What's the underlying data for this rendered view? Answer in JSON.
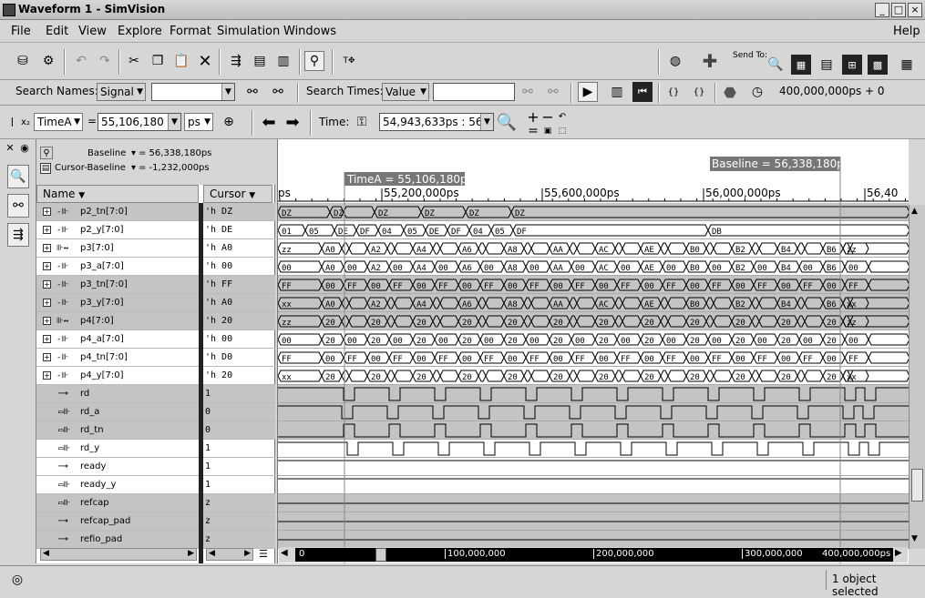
{
  "window": {
    "title": "Waveform 1 - SimVision"
  },
  "menu": [
    {
      "label": "File",
      "name": "menu-file"
    },
    {
      "label": "Edit",
      "name": "menu-edit"
    },
    {
      "label": "View",
      "name": "menu-view"
    },
    {
      "label": "Explore",
      "name": "menu-explore"
    },
    {
      "label": "Format",
      "name": "menu-format"
    },
    {
      "label": "Simulation",
      "name": "menu-simulation"
    },
    {
      "label": "Windows",
      "name": "menu-windows"
    }
  ],
  "menu_help": "Help",
  "toolbar1": {
    "send_to_label": "Send To:"
  },
  "toolbar2": {
    "search_names_label": "Search Names:",
    "search_names_type": "Signal",
    "search_names_value": "",
    "search_times_label": "Search Times:",
    "search_times_type": "Value",
    "search_times_value": "",
    "sim_time": "400,000,000ps + 0"
  },
  "toolbar3": {
    "cursor_name": "TimeA",
    "cursor_value": "55,106,180",
    "cursor_units": "ps",
    "time_label": "Time:",
    "time_range": "54,943,633ps : 56,"
  },
  "namepane": {
    "baseline_label": "Baseline",
    "baseline_value": "= 56,338,180ps",
    "cursor_baseline_label": "Cursor-Baseline",
    "cursor_baseline_value": "= -1,232,000ps",
    "col_name": "Name",
    "col_cursor": "Cursor"
  },
  "signals": [
    {
      "name": "p2_tn[7:0]",
      "cursor": "'h DZ",
      "bus": true,
      "icon": "bus"
    },
    {
      "name": "p2_y[7:0]",
      "cursor": "'h DE",
      "bus": true,
      "icon": "bus"
    },
    {
      "name": "p3[7:0]",
      "cursor": "'h A0",
      "bus": true,
      "icon": "bus-inout"
    },
    {
      "name": "p3_a[7:0]",
      "cursor": "'h 00",
      "bus": true,
      "icon": "bus"
    },
    {
      "name": "p3_tn[7:0]",
      "cursor": "'h FF",
      "bus": true,
      "icon": "bus"
    },
    {
      "name": "p3_y[7:0]",
      "cursor": "'h A0",
      "bus": true,
      "icon": "bus"
    },
    {
      "name": "p4[7:0]",
      "cursor": "'h 20",
      "bus": true,
      "icon": "bus-inout"
    },
    {
      "name": "p4_a[7:0]",
      "cursor": "'h 00",
      "bus": true,
      "icon": "bus"
    },
    {
      "name": "p4_tn[7:0]",
      "cursor": "'h D0",
      "bus": true,
      "icon": "bus"
    },
    {
      "name": "p4_y[7:0]",
      "cursor": "'h 20",
      "bus": true,
      "icon": "bus"
    },
    {
      "name": "rd",
      "cursor": "1",
      "bus": false,
      "icon": "input"
    },
    {
      "name": "rd_a",
      "cursor": "0",
      "bus": false,
      "icon": "wire"
    },
    {
      "name": "rd_tn",
      "cursor": "0",
      "bus": false,
      "icon": "wire"
    },
    {
      "name": "rd_y",
      "cursor": "1",
      "bus": false,
      "icon": "wire"
    },
    {
      "name": "ready",
      "cursor": "1",
      "bus": false,
      "icon": "input"
    },
    {
      "name": "ready_y",
      "cursor": "1",
      "bus": false,
      "icon": "wire"
    },
    {
      "name": "refcap",
      "cursor": "z",
      "bus": false,
      "icon": "wire"
    },
    {
      "name": "refcap_pad",
      "cursor": "z",
      "bus": false,
      "icon": "input"
    },
    {
      "name": "refio_pad",
      "cursor": "z",
      "bus": false,
      "icon": "input"
    }
  ],
  "waveform": {
    "baseline_marker": "Baseline = 56,338,180ps",
    "cursor_marker": "TimeA = 55,106,180ps",
    "ruler_labels": [
      "ps",
      "55,200,000ps",
      "55,600,000ps",
      "56,000,000ps",
      "56,40"
    ],
    "bus_values": {
      "p2_tn": [
        "DZ",
        "DZ",
        "DZ",
        "DZ",
        "DZ",
        "DZ"
      ],
      "p2_y": [
        "01",
        "05",
        "DE",
        "DF",
        "04",
        "05",
        "DE",
        "DF",
        "04",
        "05",
        "DF",
        "DB"
      ],
      "p3": [
        "zz",
        "A0",
        "A2",
        "A4",
        "A6",
        "A8",
        "AA",
        "AC",
        "AE",
        "B0",
        "B2",
        "B4",
        "B6",
        "zz"
      ],
      "p3_a": [
        "00",
        "A0",
        "00",
        "A2",
        "00",
        "A4",
        "00",
        "A6",
        "00",
        "A8",
        "00",
        "AA",
        "00",
        "AC",
        "00",
        "AE",
        "00",
        "B0",
        "00",
        "B2",
        "00",
        "B4",
        "00",
        "B6",
        "00"
      ],
      "p3_tn": [
        "FF",
        "00",
        "FF",
        "00",
        "FF",
        "00",
        "FF",
        "00",
        "FF",
        "00",
        "FF",
        "00",
        "FF",
        "00",
        "FF",
        "00",
        "FF",
        "00",
        "FF",
        "00",
        "FF",
        "00",
        "FF",
        "00",
        "FF"
      ],
      "p3_y": [
        "xx",
        "A0",
        "A2",
        "A4",
        "A6",
        "A8",
        "AA",
        "AC",
        "AE",
        "B0",
        "B2",
        "B4",
        "B6",
        "xx"
      ],
      "p4": [
        "zz",
        "20",
        "20",
        "20",
        "20",
        "20",
        "20",
        "20",
        "20",
        "20",
        "20",
        "20",
        "20",
        "zz"
      ],
      "p4_a": [
        "00",
        "20",
        "00",
        "20",
        "00",
        "20",
        "00",
        "20",
        "00",
        "20",
        "00",
        "20",
        "00",
        "20",
        "00",
        "20",
        "00",
        "20",
        "00",
        "20",
        "00",
        "20",
        "00",
        "20",
        "00"
      ],
      "p4_tn": [
        "FF",
        "00",
        "FF",
        "00",
        "FF",
        "00",
        "FF",
        "00",
        "FF",
        "00",
        "FF",
        "00",
        "FF",
        "00",
        "FF",
        "00",
        "FF",
        "00",
        "FF",
        "00",
        "FF",
        "00",
        "FF",
        "00",
        "FF"
      ],
      "p4_y": [
        "xx",
        "20",
        "20",
        "20",
        "20",
        "20",
        "20",
        "20",
        "20",
        "20",
        "20",
        "20",
        "20",
        "xx"
      ]
    }
  },
  "timeline": {
    "labels": [
      "0",
      "100,000,000",
      "200,000,000",
      "300,000,000",
      "400,000,000ps"
    ]
  },
  "status": {
    "text": "1 object selected"
  }
}
